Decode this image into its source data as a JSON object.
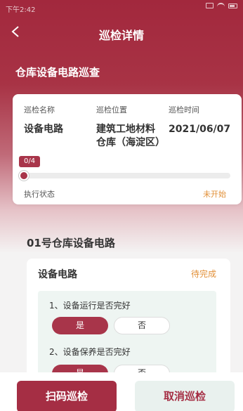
{
  "status_bar": {
    "time": "下午2:42"
  },
  "header": {
    "title": "巡检详情"
  },
  "task": {
    "title": "仓库设备电路巡查"
  },
  "info": {
    "name_label": "巡检名称",
    "location_label": "巡检位置",
    "time_label": "巡检时间",
    "name_value": "设备电路",
    "location_value_line1": "建筑工地材料",
    "location_value_line2": "仓库（海淀区）",
    "time_value": "2021/06/07",
    "progress_text": "0/4",
    "progress_fraction": 0,
    "exec_label": "执行状态",
    "exec_status": "未开始"
  },
  "section": {
    "title": "01号仓库设备电路"
  },
  "check_card": {
    "title": "设备电路",
    "status": "待完成",
    "questions": [
      {
        "text": "1、设备运行是否完好",
        "yes": "是",
        "no": "否"
      },
      {
        "text": "2、设备保养是否完好",
        "yes": "是",
        "no": "否"
      }
    ]
  },
  "actions": {
    "scan": "扫码巡检",
    "cancel": "取消巡检"
  },
  "colors": {
    "primary": "#a52e44",
    "warning": "#e29038",
    "accent_bg": "#eef5f2"
  }
}
